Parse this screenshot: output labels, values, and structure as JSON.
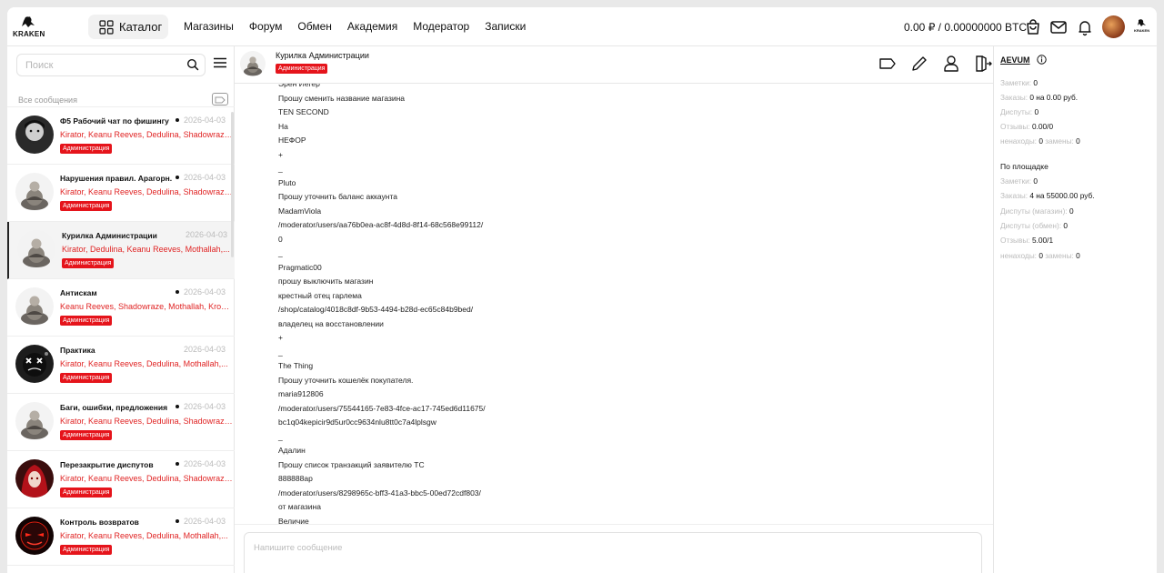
{
  "nav": {
    "logo_text": "KRAKEN",
    "catalog_label": "Каталог",
    "links": [
      "Магазины",
      "Форум",
      "Обмен",
      "Академия",
      "Модератор",
      "Записки"
    ],
    "balance": "0.00 ₽ / 0.00000000 BTC",
    "small_logo_text": "KRAKEN"
  },
  "sidebar": {
    "search_placeholder": "Поиск",
    "all_messages": "Все сообщения",
    "chats": [
      {
        "title": "Ф5 Рабочий чат по фишингу",
        "unread": true,
        "date": "2026-04-03",
        "members": "Kirator, Keanu Reeves, Dedulina, Shadowraze,...",
        "badge": "Администрация",
        "avatar": "bearded"
      },
      {
        "title": "Нарушения правил. Арагорн.",
        "unread": true,
        "date": "2026-04-03",
        "members": "Kirator, Keanu Reeves, Dedulina, Shadowraze,...",
        "badge": "Администрация",
        "avatar": "monk"
      },
      {
        "title": "Курилка Администрации",
        "unread": false,
        "date": "2026-04-03",
        "members": "Kirator, Dedulina, Keanu Reeves, Mothallah,...",
        "badge": "Администрация",
        "avatar": "monk",
        "active": true
      },
      {
        "title": "Антискам",
        "unread": true,
        "date": "2026-04-03",
        "members": "Keanu Reeves, Shadowraze, Mothallah, Krono...",
        "badge": "Администрация",
        "avatar": "monk"
      },
      {
        "title": "Практика",
        "unread": false,
        "date": "2026-04-03",
        "members": "Kirator, Keanu Reeves, Dedulina, Mothallah,...",
        "badge": "Администрация",
        "avatar": "xeyes"
      },
      {
        "title": "Баги, ошибки, предложения",
        "unread": true,
        "date": "2026-04-03",
        "members": "Kirator, Keanu Reeves, Dedulina, Shadowraze,...",
        "badge": "Администрация",
        "avatar": "monk"
      },
      {
        "title": "Перезакрытие диспутов",
        "unread": true,
        "date": "2026-04-03",
        "members": "Kirator, Keanu Reeves, Dedulina, Shadowraze,...",
        "badge": "Администрация",
        "avatar": "redhair"
      },
      {
        "title": "Контроль возвратов",
        "unread": true,
        "date": "2026-04-03",
        "members": "Kirator, Keanu Reeves, Dedulina, Mothallah,...",
        "badge": "Администрация",
        "avatar": "redmask"
      }
    ]
  },
  "chat": {
    "title": "Курилка Администрации",
    "badge": "Администрация",
    "lines": [
      "Эрен Йегер",
      "Прошу сменить название магазина",
      "TEN SECOND",
      "На",
      "НЕФОР",
      "+",
      "_",
      "Pluto",
      "Прошу уточнить баланс аккаунта",
      "MadamViola",
      "/moderator/users/aa76b0ea-ac8f-4d8d-8f14-68c568e99112/",
      "0",
      "_",
      "Pragmatic00",
      "прошу выключить магазин",
      "крестный отец гарлема",
      "/shop/catalog/4018c8df-9b53-4494-b28d-ec65c84b9bed/",
      "владелец на восстановлении",
      "+",
      "_",
      "The Thing",
      "Прошу уточнить кошелёк покупателя.",
      "maria912806",
      "/moderator/users/75544165-7e83-4fce-ac17-745ed6d11675/",
      "bc1q04kepicir9d5ur0cc9634nlu8tt0c7a4lplsgw",
      "_",
      "Адалин",
      "Прошу список транзакций заявителю ТС",
      "888888ap",
      "/moderator/users/8298965c-bff3-41a3-bbc5-00ed72cdf803/",
      "от магазина",
      "Величие"
    ],
    "composer_placeholder": "Напишите сообщение"
  },
  "info": {
    "username": "AEVUM",
    "personal": {
      "notes_label": "Заметки:",
      "notes": "0",
      "orders_label": "Заказы:",
      "orders": "0 на 0.00 руб.",
      "disputes_label": "Диспуты:",
      "disputes": "0",
      "reviews_label": "Отзывы:",
      "reviews": "0.00/0",
      "notfound_label": "ненаходы:",
      "notfound": "0",
      "replacements_label": "замены:",
      "replacements": "0"
    },
    "platform_title": "По площадке",
    "platform": {
      "notes_label": "Заметки:",
      "notes": "0",
      "orders_label": "Заказы:",
      "orders": "4 на 55000.00 руб.",
      "disputes_shop_label": "Диспуты (магазин):",
      "disputes_shop": "0",
      "disputes_exchange_label": "Диспуты (обмен):",
      "disputes_exchange": "0",
      "reviews_label": "Отзывы:",
      "reviews": "5.00/1",
      "notfound_label": "ненаходы:",
      "notfound": "0",
      "replacements_label": "замены:",
      "replacements": "0"
    }
  },
  "colors": {
    "accent_red": "#e5141b",
    "member_red": "#e02424"
  }
}
